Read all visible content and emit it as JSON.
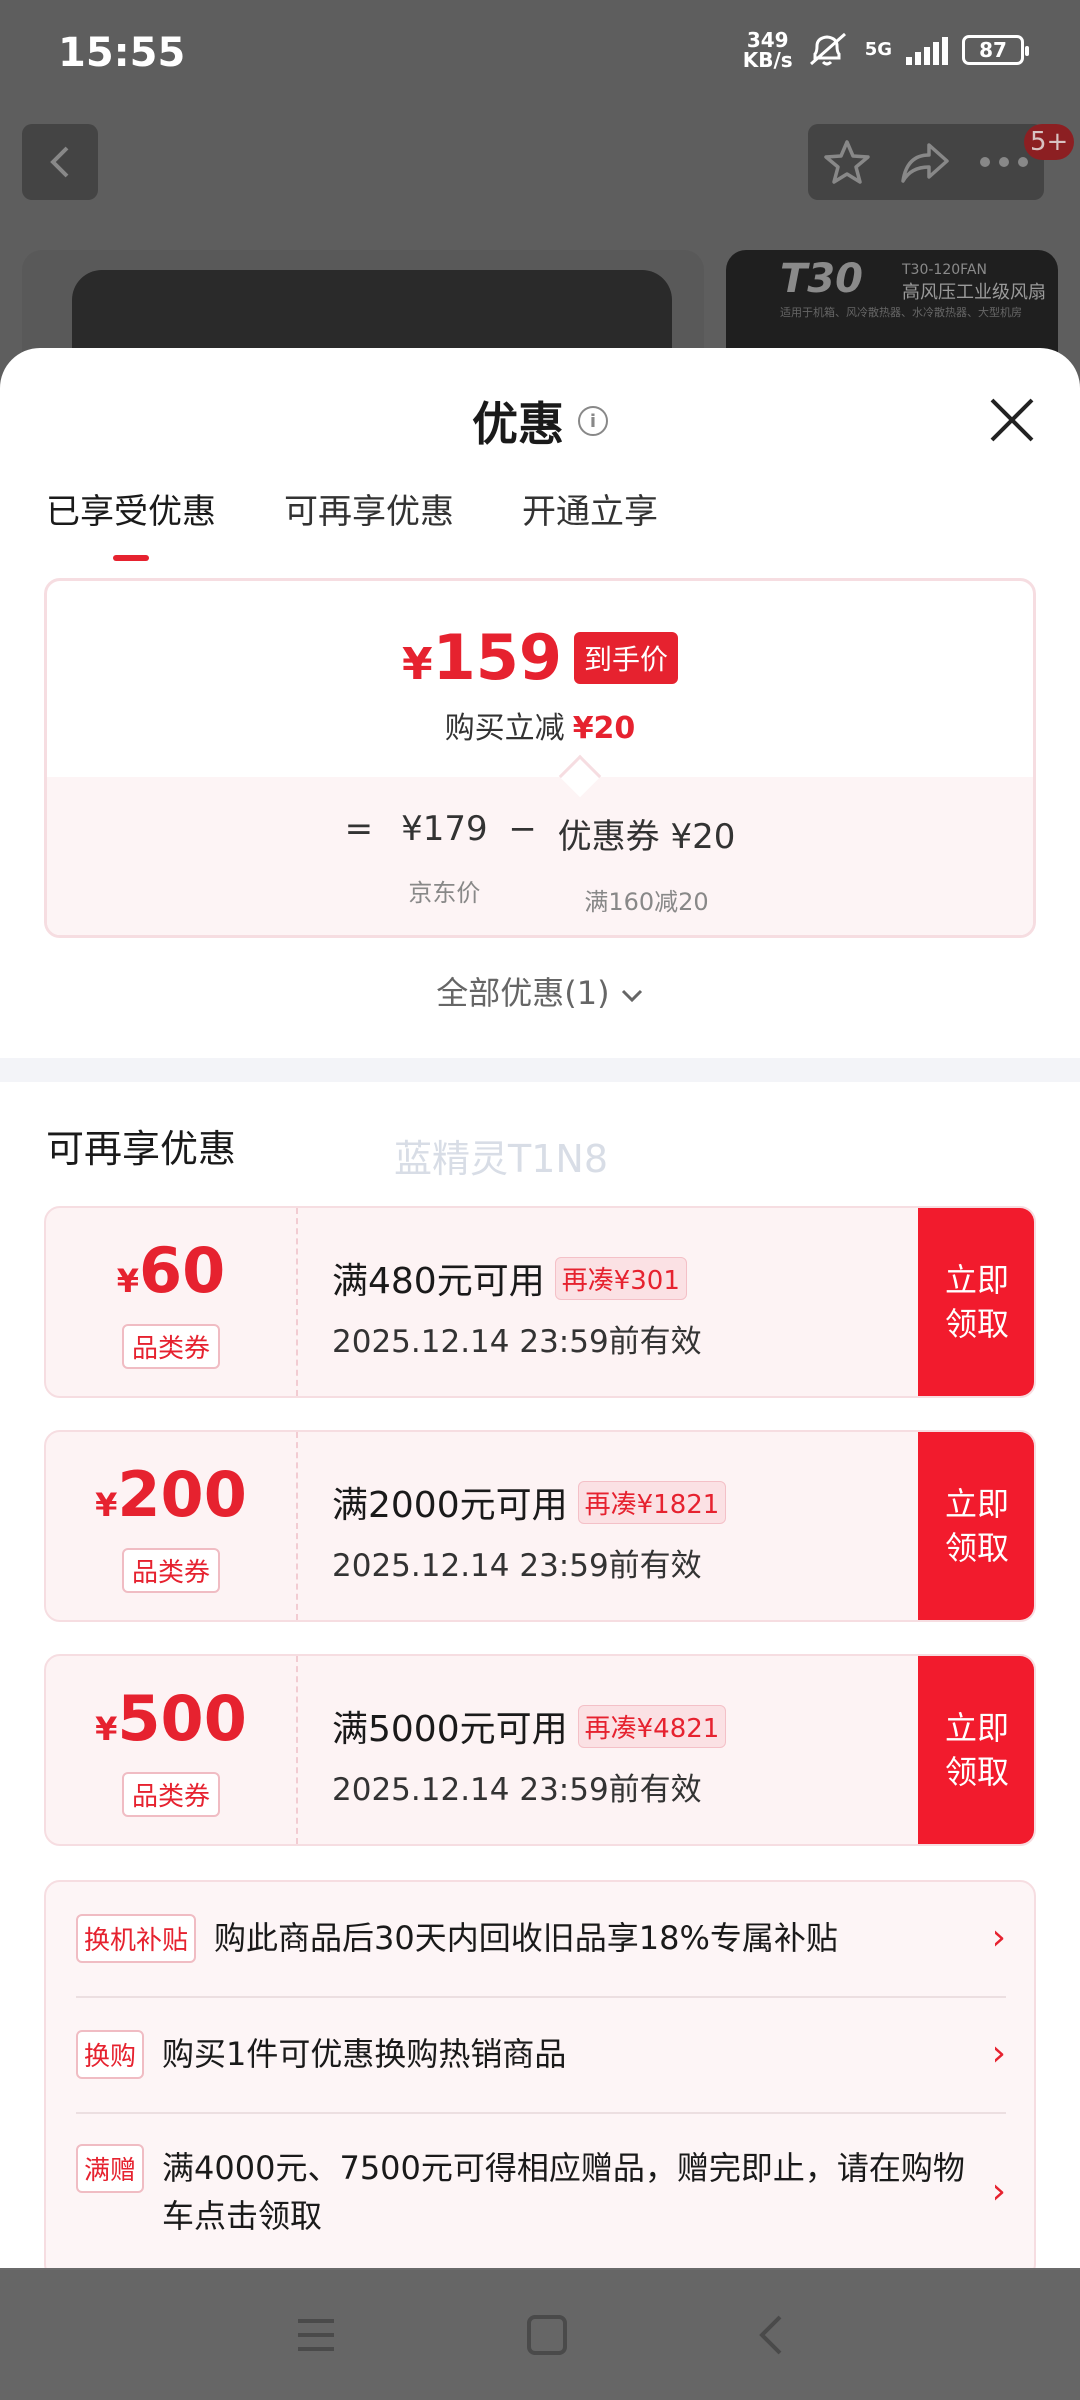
{
  "status_bar": {
    "time": "15:55",
    "net_speed_value": "349",
    "net_speed_unit": "KB/s",
    "network": "5G",
    "battery": "87"
  },
  "background": {
    "badge": "5+",
    "product2_brand": "T30",
    "product2_model": "T30-120FAN",
    "product2_subtitle": "高风压工业级风扇",
    "product2_desc": "适用于机箱、风冷散热器、水冷散热器、大型机房"
  },
  "sheet": {
    "title": "优惠",
    "tabs": [
      {
        "label": "已享受优惠",
        "active": true
      },
      {
        "label": "可再享优惠",
        "active": false
      },
      {
        "label": "开通立享",
        "active": false
      }
    ],
    "price_card": {
      "currency": "¥",
      "final_price": "159",
      "price_tag": "到手价",
      "reduce_label": "购买立减",
      "reduce_value": "¥20",
      "equals": "=",
      "jd_price": "¥179",
      "jd_price_label": "京东价",
      "minus": "−",
      "coupon_value": "优惠券 ¥20",
      "coupon_label": "满160减20"
    },
    "all_discounts": "全部优惠(1)",
    "section_title": "可再享优惠",
    "watermark": "蓝精灵T1N8",
    "coupons": [
      {
        "currency": "¥",
        "amount": "60",
        "type": "品类券",
        "condition": "满480元可用",
        "need": "再凑¥301",
        "valid": "2025.12.14 23:59前有效",
        "btn_line1": "立即",
        "btn_line2": "领取"
      },
      {
        "currency": "¥",
        "amount": "200",
        "type": "品类券",
        "condition": "满2000元可用",
        "need": "再凑¥1821",
        "valid": "2025.12.14 23:59前有效",
        "btn_line1": "立即",
        "btn_line2": "领取"
      },
      {
        "currency": "¥",
        "amount": "500",
        "type": "品类券",
        "condition": "满5000元可用",
        "need": "再凑¥4821",
        "valid": "2025.12.14 23:59前有效",
        "btn_line1": "立即",
        "btn_line2": "领取"
      }
    ],
    "perks": [
      {
        "tag": "换机补贴",
        "text": "购此商品后30天内回收旧品享18%专属补贴",
        "arrow": "›"
      },
      {
        "tag": "换购",
        "text": "购买1件可优惠换购热销商品",
        "arrow": "›"
      },
      {
        "tag": "满赠",
        "text": "满4000元、7500元可得相应赠品，赠完即止，请在购物车点击领取",
        "arrow": "›"
      }
    ]
  },
  "colors": {
    "accent_red": "#e6222f",
    "button_red": "#f21b2d",
    "card_bg": "#fdf3f4",
    "overlay": "#6b6b6b"
  },
  "icons": [
    "back-icon",
    "star-icon",
    "share-icon",
    "more-icon",
    "info-icon",
    "close-icon",
    "chevron-down-icon",
    "menu-icon",
    "home-icon",
    "back-nav-icon"
  ]
}
